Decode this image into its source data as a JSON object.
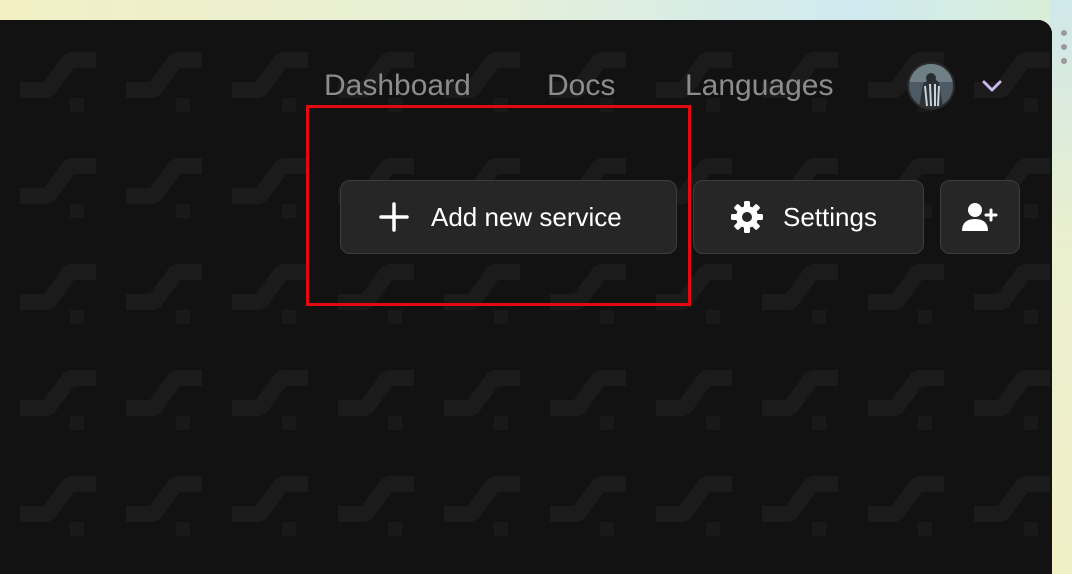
{
  "nav": {
    "links": [
      {
        "label": "Dashboard"
      },
      {
        "label": "Docs"
      },
      {
        "label": "Languages"
      }
    ]
  },
  "user": {
    "avatar_icon": "user-avatar",
    "menu_icon": "chevron-down-icon"
  },
  "actions": {
    "add_service_label": "Add new service",
    "settings_label": "Settings",
    "add_user_icon": "user-plus-icon"
  },
  "colors": {
    "window_bg": "#121212",
    "button_bg": "#262626",
    "nav_text": "#8c8c8c",
    "highlight": "#e3090f",
    "chevron": "#c9b8ee"
  }
}
